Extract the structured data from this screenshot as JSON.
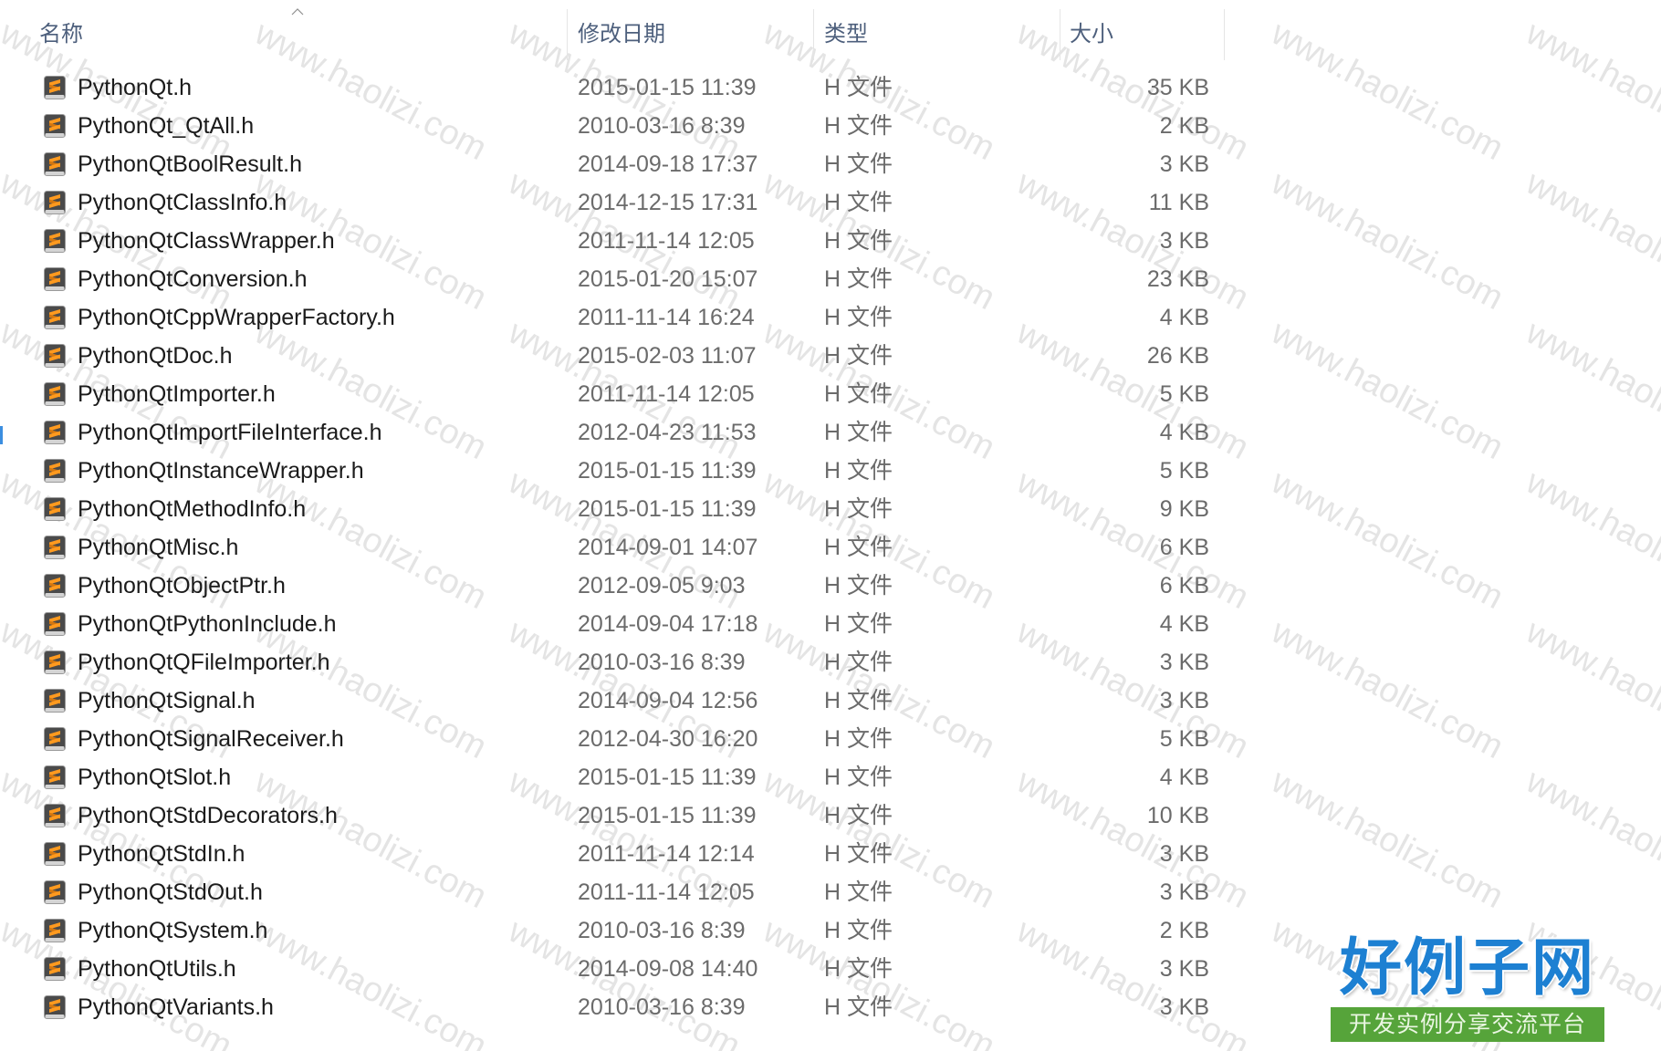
{
  "header": {
    "name": "名称",
    "modified": "修改日期",
    "type": "类型",
    "size": "大小"
  },
  "files": [
    {
      "name": "PythonQt.h",
      "modified": "2015-01-15 11:39",
      "type": "H 文件",
      "size": "35 KB"
    },
    {
      "name": "PythonQt_QtAll.h",
      "modified": "2010-03-16 8:39",
      "type": "H 文件",
      "size": "2 KB"
    },
    {
      "name": "PythonQtBoolResult.h",
      "modified": "2014-09-18 17:37",
      "type": "H 文件",
      "size": "3 KB"
    },
    {
      "name": "PythonQtClassInfo.h",
      "modified": "2014-12-15 17:31",
      "type": "H 文件",
      "size": "11 KB"
    },
    {
      "name": "PythonQtClassWrapper.h",
      "modified": "2011-11-14 12:05",
      "type": "H 文件",
      "size": "3 KB"
    },
    {
      "name": "PythonQtConversion.h",
      "modified": "2015-01-20 15:07",
      "type": "H 文件",
      "size": "23 KB"
    },
    {
      "name": "PythonQtCppWrapperFactory.h",
      "modified": "2011-11-14 16:24",
      "type": "H 文件",
      "size": "4 KB"
    },
    {
      "name": "PythonQtDoc.h",
      "modified": "2015-02-03 11:07",
      "type": "H 文件",
      "size": "26 KB"
    },
    {
      "name": "PythonQtImporter.h",
      "modified": "2011-11-14 12:05",
      "type": "H 文件",
      "size": "5 KB"
    },
    {
      "name": "PythonQtImportFileInterface.h",
      "modified": "2012-04-23 11:53",
      "type": "H 文件",
      "size": "4 KB"
    },
    {
      "name": "PythonQtInstanceWrapper.h",
      "modified": "2015-01-15 11:39",
      "type": "H 文件",
      "size": "5 KB"
    },
    {
      "name": "PythonQtMethodInfo.h",
      "modified": "2015-01-15 11:39",
      "type": "H 文件",
      "size": "9 KB"
    },
    {
      "name": "PythonQtMisc.h",
      "modified": "2014-09-01 14:07",
      "type": "H 文件",
      "size": "6 KB"
    },
    {
      "name": "PythonQtObjectPtr.h",
      "modified": "2012-09-05 9:03",
      "type": "H 文件",
      "size": "6 KB"
    },
    {
      "name": "PythonQtPythonInclude.h",
      "modified": "2014-09-04 17:18",
      "type": "H 文件",
      "size": "4 KB"
    },
    {
      "name": "PythonQtQFileImporter.h",
      "modified": "2010-03-16 8:39",
      "type": "H 文件",
      "size": "3 KB"
    },
    {
      "name": "PythonQtSignal.h",
      "modified": "2014-09-04 12:56",
      "type": "H 文件",
      "size": "3 KB"
    },
    {
      "name": "PythonQtSignalReceiver.h",
      "modified": "2012-04-30 16:20",
      "type": "H 文件",
      "size": "5 KB"
    },
    {
      "name": "PythonQtSlot.h",
      "modified": "2015-01-15 11:39",
      "type": "H 文件",
      "size": "4 KB"
    },
    {
      "name": "PythonQtStdDecorators.h",
      "modified": "2015-01-15 11:39",
      "type": "H 文件",
      "size": "10 KB"
    },
    {
      "name": "PythonQtStdIn.h",
      "modified": "2011-11-14 12:14",
      "type": "H 文件",
      "size": "3 KB"
    },
    {
      "name": "PythonQtStdOut.h",
      "modified": "2011-11-14 12:05",
      "type": "H 文件",
      "size": "3 KB"
    },
    {
      "name": "PythonQtSystem.h",
      "modified": "2010-03-16 8:39",
      "type": "H 文件",
      "size": "2 KB"
    },
    {
      "name": "PythonQtUtils.h",
      "modified": "2014-09-08 14:40",
      "type": "H 文件",
      "size": "3 KB"
    },
    {
      "name": "PythonQtVariants.h",
      "modified": "2010-03-16 8:39",
      "type": "H 文件",
      "size": "3 KB"
    }
  ],
  "watermark": {
    "text": "www.haolizi.com"
  },
  "logo": {
    "title": "好例子网",
    "tagline": "开发实例分享交流平台"
  },
  "icons": {
    "file": "sublime-text-file-icon",
    "sort": "chevron-up-icon"
  },
  "colors": {
    "background": "#ffffff",
    "name_text": "#1b1b1b",
    "meta_text": "#6b6b6b",
    "header_text": "#4d5f7c",
    "header_divider": "#e5e5e5",
    "watermark": "#e4e4e4",
    "logo_blue": "#1d80d2",
    "logo_green": "#56a43a",
    "logo_tagline": "#eaf6e2",
    "nav_edge": "#3c8ee0"
  }
}
